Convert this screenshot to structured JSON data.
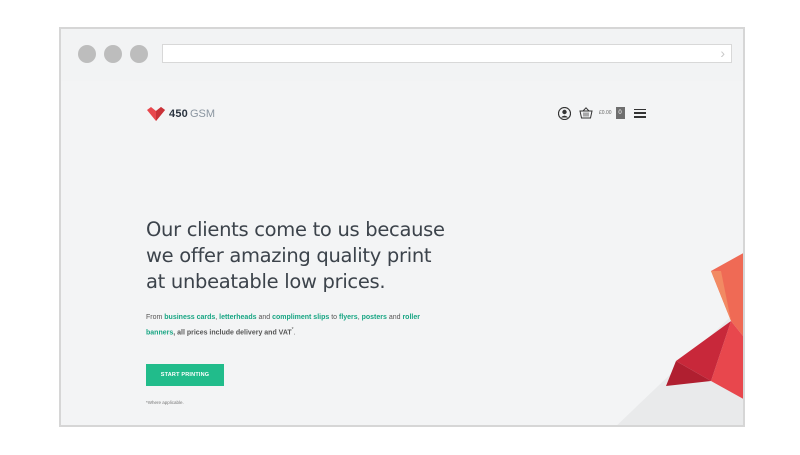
{
  "browser": {
    "address": ""
  },
  "logo": {
    "number": "450",
    "text": "GSM"
  },
  "nav": {
    "price": "£0.00",
    "count": "0"
  },
  "hero": {
    "headline": "Our clients come to us because we offer amazing quality print at unbeatable low prices.",
    "sub": {
      "from": "From ",
      "link1": "business cards",
      "sep1": ", ",
      "link2": "letterheads",
      "and1": " and ",
      "link3": "compliment slips",
      "to": " to ",
      "link4": "flyers",
      "sep2": ", ",
      "link5": "posters",
      "and2": " and ",
      "link6": "roller banners",
      "tail": ", all prices include delivery and VAT",
      "star": "*",
      "end": "."
    },
    "cta": "START PRINTING",
    "footnote": "*Where applicable."
  },
  "colors": {
    "accent": "#21bc8b",
    "brand_red": "#e8474d",
    "text": "#3c434b"
  },
  "icons": [
    "user-icon",
    "basket-icon",
    "menu-icon",
    "heart-logo-icon",
    "chevron-right-icon"
  ]
}
